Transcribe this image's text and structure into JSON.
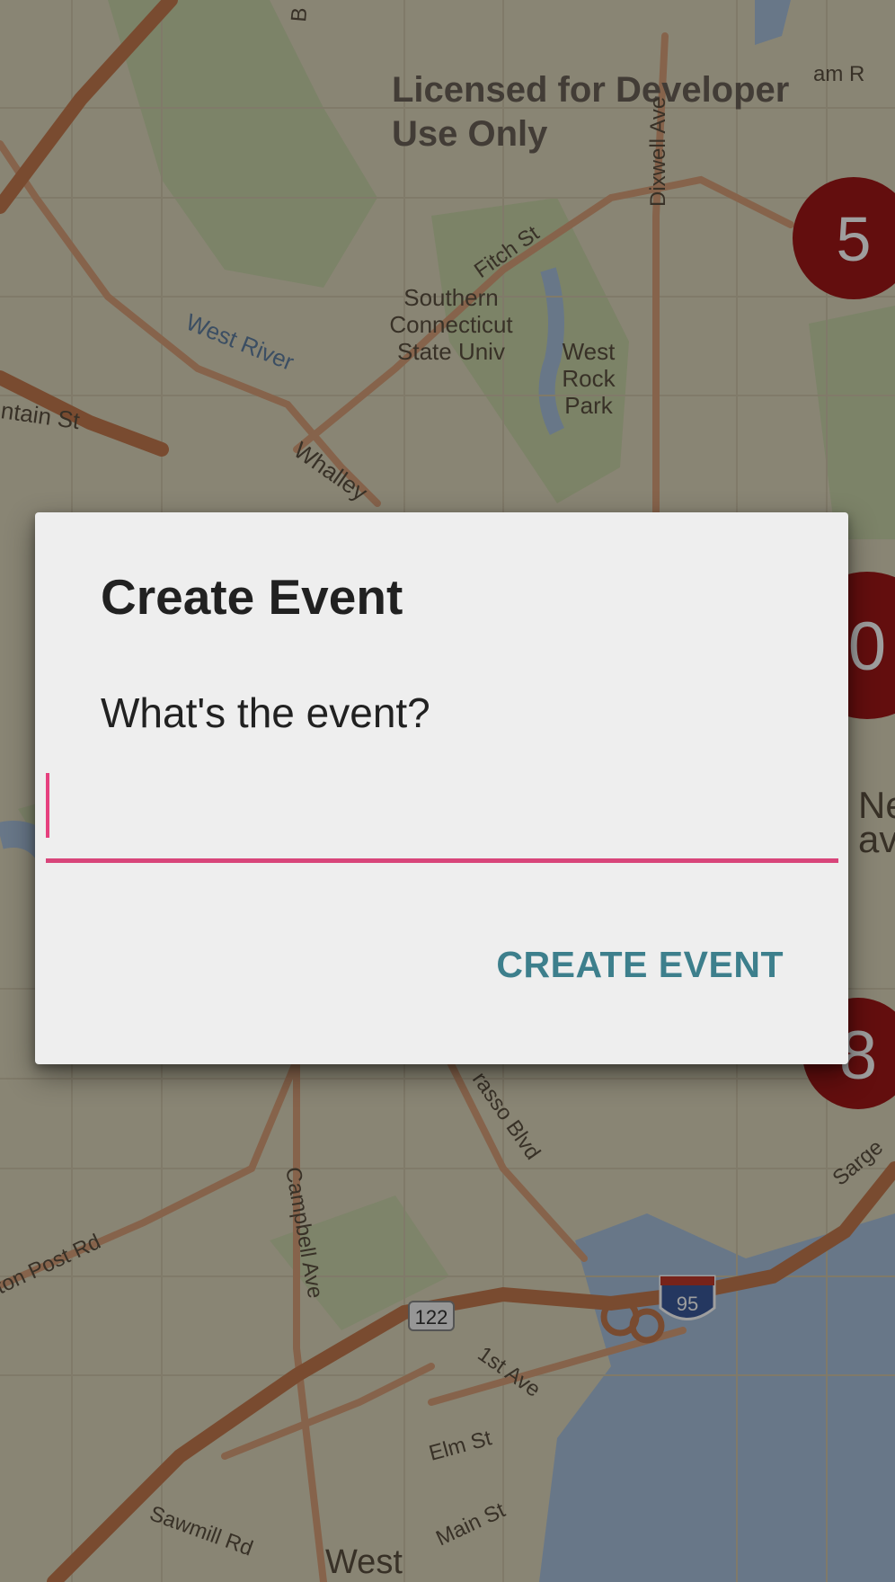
{
  "map": {
    "license_text_line1": "Licensed for Developer",
    "license_text_line2": "Use Only",
    "labels": {
      "southern_line1": "Southern",
      "southern_line2": "Connecticut",
      "southern_line3": "State Univ",
      "west_rock_line1": "West",
      "west_rock_line2": "Rock",
      "west_rock_line3": "Park",
      "west_river": "West River",
      "fitch_st": "Fitch St",
      "dixwell_ave": "Dixwell Ave",
      "whalley": "Whalley",
      "mountain_st": "ntain St",
      "top_right": "am R",
      "top_mid": "B",
      "new_haven_1": "Ne",
      "new_haven_2": "av",
      "derby_post_rd": "ton Post Rd",
      "campbell_ave": "Campbell Ave",
      "ella_grasso_blvd": "rasso Blvd",
      "first_ave": "1st Ave",
      "elm_st": "Elm St",
      "main_st": "Main St",
      "sawmill_rd": "Sawmill Rd",
      "sargent": "Sarge",
      "west": "West",
      "route_122": "122",
      "interstate_95": "95"
    },
    "markers": [
      {
        "label": "5"
      },
      {
        "label": "0"
      },
      {
        "label": "8"
      }
    ]
  },
  "dialog": {
    "title": "Create Event",
    "message": "What's the event?",
    "input_value": "",
    "input_placeholder": "",
    "create_button_label": "CREATE EVENT"
  },
  "colors": {
    "accent_pink": "#e6407e",
    "button_teal": "#3d7f8c",
    "marker_red": "#a01818",
    "dialog_bg": "#eeeeee"
  }
}
